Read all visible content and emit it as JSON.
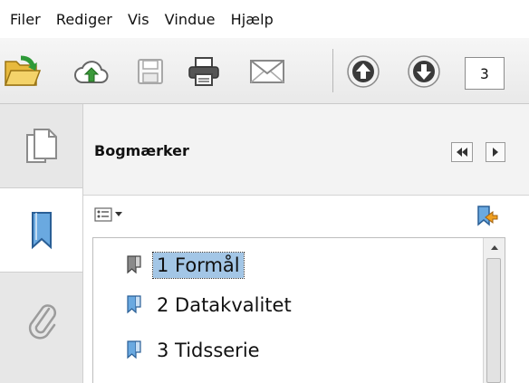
{
  "menu": {
    "items": [
      {
        "label": "Filer"
      },
      {
        "label": "Rediger"
      },
      {
        "label": "Vis"
      },
      {
        "label": "Vindue"
      },
      {
        "label": "Hjælp"
      }
    ]
  },
  "toolbar": {
    "buttons": [
      {
        "name": "open",
        "icon": "folder-open-icon"
      },
      {
        "name": "upload-cloud",
        "icon": "cloud-upload-icon"
      },
      {
        "name": "save",
        "icon": "floppy-disk-icon"
      },
      {
        "name": "print",
        "icon": "printer-icon"
      },
      {
        "name": "email",
        "icon": "envelope-icon"
      },
      {
        "name": "previous-page",
        "icon": "arrow-up-circle-icon"
      },
      {
        "name": "next-page",
        "icon": "arrow-down-circle-icon"
      }
    ],
    "page_number": "3"
  },
  "sidebar": {
    "tabs": [
      {
        "name": "pages",
        "icon": "pages-icon"
      },
      {
        "name": "bookmarks",
        "icon": "bookmark-ribbon-icon",
        "active": true
      },
      {
        "name": "attachments",
        "icon": "paperclip-icon"
      }
    ]
  },
  "bookmarks_panel": {
    "title": "Bogmærker",
    "items": [
      {
        "label": "1 Formål",
        "selected": true
      },
      {
        "label": "2 Datakvalitet",
        "selected": false
      },
      {
        "label": "3 Tidsserie",
        "selected": false
      }
    ]
  },
  "colors": {
    "selection": "#a3c6e6",
    "arrow_button": "#1f5f94",
    "bookmark_blue": "#4a86c8"
  }
}
